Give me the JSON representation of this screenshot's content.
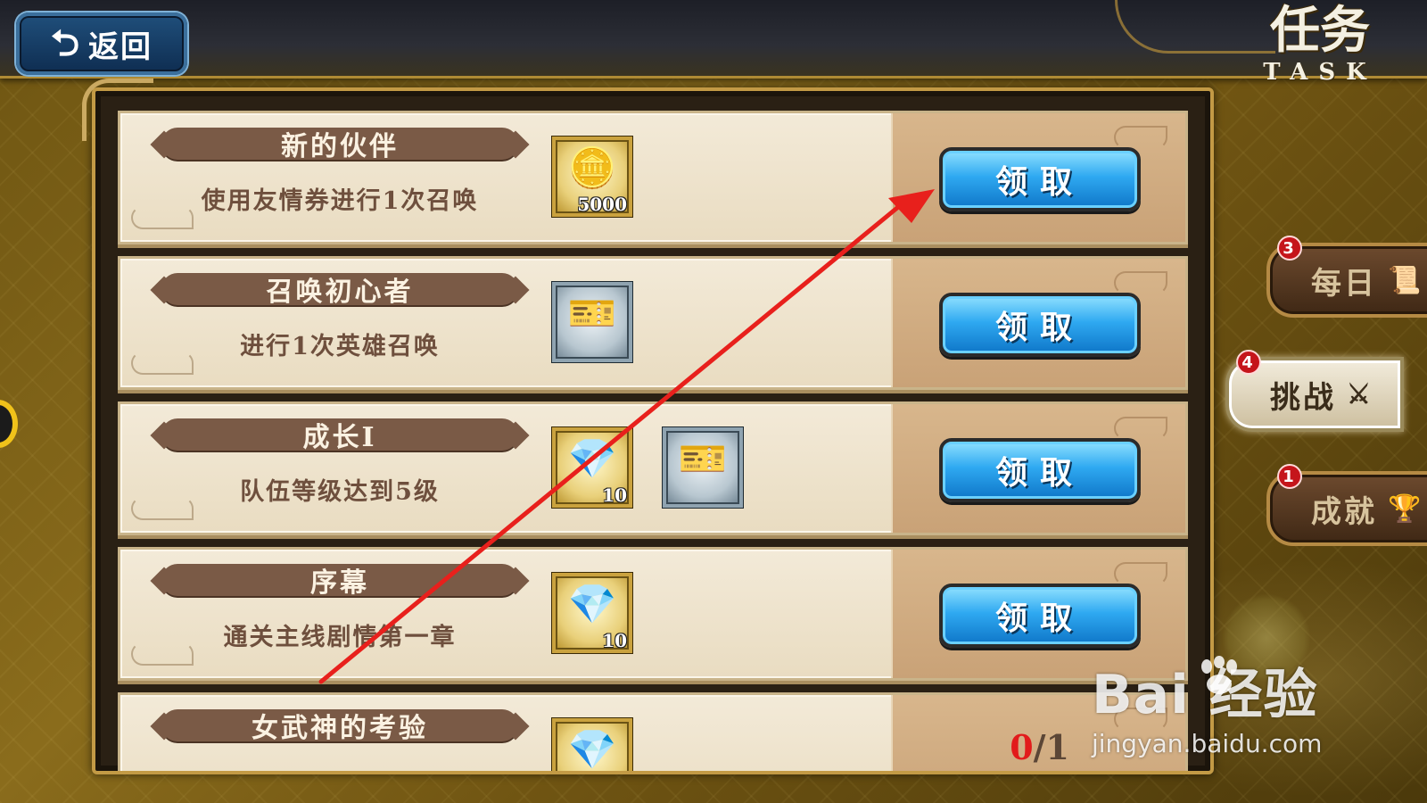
{
  "header": {
    "back_label": "返回",
    "back_icon": "return-arrow-icon",
    "title": "任务",
    "subtitle": "TASK"
  },
  "tasks": [
    {
      "name": "新的伙伴",
      "description": "使用友情券进行1次召唤",
      "rewards": [
        {
          "icon": "gold-coin-icon",
          "glyph": "🪙",
          "quantity": "5000",
          "frame": "gold"
        }
      ],
      "action": "领取"
    },
    {
      "name": "召唤初心者",
      "description": "进行1次英雄召唤",
      "rewards": [
        {
          "icon": "summon-ticket-icon",
          "glyph": "🎫",
          "quantity": "",
          "frame": "silver"
        }
      ],
      "action": "领取"
    },
    {
      "name": "成长I",
      "description": "队伍等级达到5级",
      "rewards": [
        {
          "icon": "rainbow-crystal-icon",
          "glyph": "💎",
          "quantity": "10",
          "frame": "gold"
        },
        {
          "icon": "summon-ticket-icon",
          "glyph": "🎫",
          "quantity": "",
          "frame": "silver"
        }
      ],
      "action": "领取"
    },
    {
      "name": "序幕",
      "description": "通关主线剧情第一章",
      "rewards": [
        {
          "icon": "rainbow-crystal-icon",
          "glyph": "💎",
          "quantity": "10",
          "frame": "gold"
        }
      ],
      "action": "领取"
    },
    {
      "name": "女武神的考验",
      "description": "",
      "rewards": [
        {
          "icon": "rainbow-crystal-icon",
          "glyph": "💎",
          "quantity": "",
          "frame": "gold"
        }
      ],
      "progress_current": "0",
      "progress_total": "1"
    }
  ],
  "side_tabs": [
    {
      "label": "每日",
      "badge": "3",
      "icon": "scroll-icon",
      "glyph": "📜",
      "active": false
    },
    {
      "label": "挑战",
      "badge": "4",
      "icon": "crossed-swords-icon",
      "glyph": "⚔",
      "active": true
    },
    {
      "label": "成就",
      "badge": "1",
      "icon": "trophy-icon",
      "glyph": "🏆",
      "active": false
    }
  ],
  "watermark": {
    "brand": "Bai 经验",
    "url": "jingyan.baidu.com"
  },
  "colors": {
    "claim_button": "#2fa9f1",
    "progress_current": "#e21b1b",
    "annotation_arrow": "#e8201c",
    "badge": "#c5151b"
  }
}
